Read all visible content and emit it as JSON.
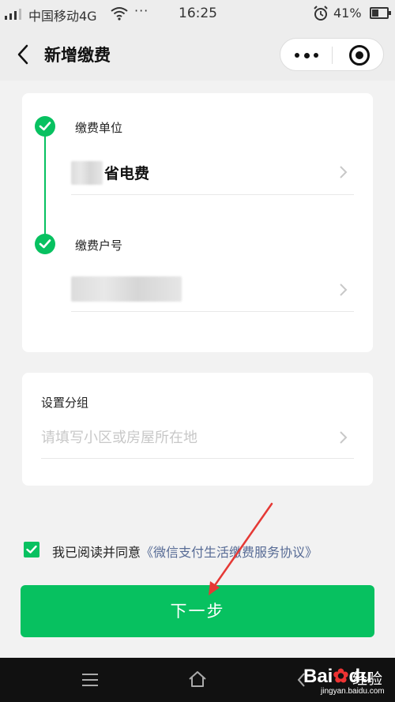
{
  "status_bar": {
    "carrier": "中国移动4G",
    "overflow_dots": "···",
    "time": "16:25",
    "battery_percent": "41%",
    "battery_level": 0.41
  },
  "nav": {
    "title": "新增缴费",
    "icons": [
      "back-chevron-icon",
      "more-dots-icon",
      "miniprogram-close-icon"
    ]
  },
  "form": {
    "unit_label": "缴费单位",
    "unit_value": "省电费",
    "account_label": "缴费户号",
    "group_label": "设置分组",
    "group_placeholder": "请填写小区或房屋所在地"
  },
  "agreement": {
    "text": "我已阅读并同意",
    "link": "《微信支付生活缴费服务协议》",
    "checked": true
  },
  "next_button": "下一步",
  "watermark": {
    "brand": "Bai",
    "brand_suffix": "du",
    "cn": "经验",
    "url": "jingyan.baidu.com"
  },
  "colors": {
    "accent": "#07c160",
    "link": "#576b95",
    "annotation_arrow": "#e53935"
  }
}
